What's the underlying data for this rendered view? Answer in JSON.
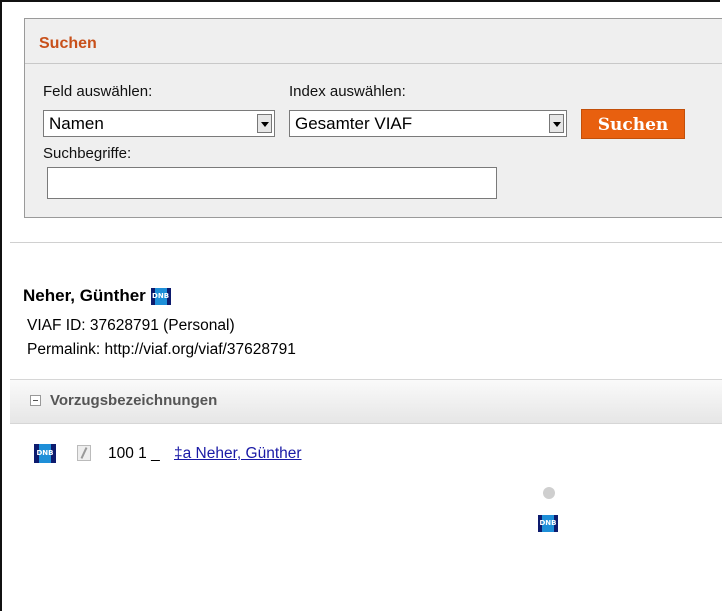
{
  "search": {
    "title": "Suchen",
    "field_label": "Feld auswählen:",
    "field_value": "Namen",
    "index_label": "Index auswählen:",
    "index_value": "Gesamter VIAF",
    "button_label": "Suchen",
    "terms_label": "Suchbegriffe:",
    "terms_value": ""
  },
  "record": {
    "name": "Neher, Günther",
    "viaf_id_line": "VIAF ID: 37628791 (Personal)",
    "permalink_line": "Permalink: http://viaf.org/viaf/37628791"
  },
  "preferred": {
    "section_title": "Vorzugsbezeichnungen",
    "rows": [
      {
        "tag": "100 1 _",
        "subfield_link": "‡a  Neher, Günther"
      }
    ]
  },
  "colors": {
    "accent": "#e8600f",
    "title": "#c8501a",
    "dnb_dark": "#0d1b6e",
    "dnb_light": "#1e8fd8",
    "link": "#1a1aa6"
  }
}
